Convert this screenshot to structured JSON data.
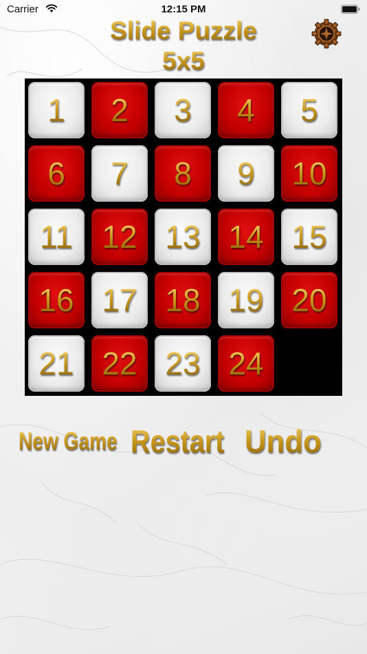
{
  "status_bar": {
    "carrier": "Carrier",
    "time": "12:15 PM",
    "wifi_icon": "wifi-icon",
    "battery_icon": "battery-icon"
  },
  "header": {
    "title": "Slide Puzzle",
    "size_label": "5x5",
    "settings_icon": "gear-icon"
  },
  "board": {
    "rows": 5,
    "cols": 5,
    "empty_cell": {
      "row": 4,
      "col": 4
    },
    "tiles": [
      {
        "label": "1",
        "color": "white"
      },
      {
        "label": "2",
        "color": "red"
      },
      {
        "label": "3",
        "color": "white"
      },
      {
        "label": "4",
        "color": "red"
      },
      {
        "label": "5",
        "color": "white"
      },
      {
        "label": "6",
        "color": "red"
      },
      {
        "label": "7",
        "color": "white"
      },
      {
        "label": "8",
        "color": "red"
      },
      {
        "label": "9",
        "color": "white"
      },
      {
        "label": "10",
        "color": "red"
      },
      {
        "label": "11",
        "color": "white"
      },
      {
        "label": "12",
        "color": "red"
      },
      {
        "label": "13",
        "color": "white"
      },
      {
        "label": "14",
        "color": "red"
      },
      {
        "label": "15",
        "color": "white"
      },
      {
        "label": "16",
        "color": "red"
      },
      {
        "label": "17",
        "color": "white"
      },
      {
        "label": "18",
        "color": "red"
      },
      {
        "label": "19",
        "color": "white"
      },
      {
        "label": "20",
        "color": "red"
      },
      {
        "label": "21",
        "color": "white"
      },
      {
        "label": "22",
        "color": "red"
      },
      {
        "label": "23",
        "color": "white"
      },
      {
        "label": "24",
        "color": "red"
      }
    ]
  },
  "controls": {
    "new_game": "New Game",
    "restart": "Restart",
    "undo": "Undo"
  },
  "colors": {
    "gold": "#c8961a",
    "tile_red": "#c40000",
    "tile_white": "#ececec",
    "board_bg": "#000000"
  }
}
